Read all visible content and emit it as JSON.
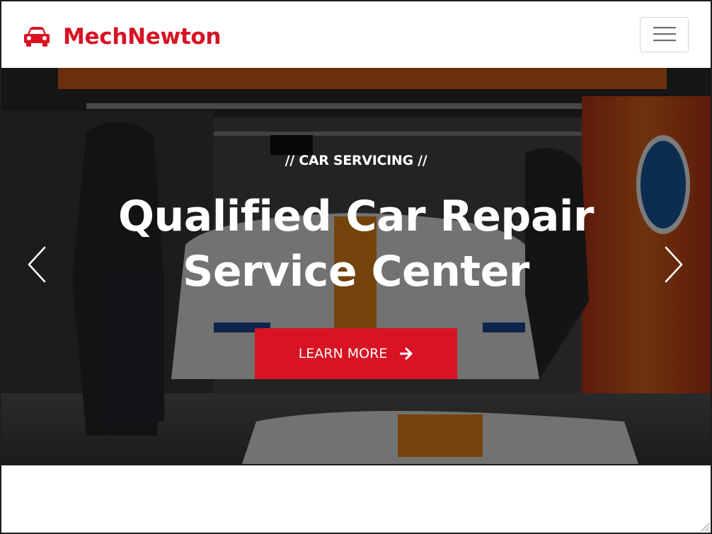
{
  "navbar": {
    "brand_name": "MechNewton",
    "brand_icon": "car-icon",
    "toggler_icon": "hamburger-menu-icon"
  },
  "hero": {
    "kicker": "// CAR SERVICING //",
    "headline_line1": "Qualified Car Repair",
    "headline_line2": "Service Center",
    "cta_label": "LEARN MORE",
    "cta_icon": "arrow-right-icon",
    "prev_icon": "chevron-left-icon",
    "next_icon": "chevron-right-icon"
  },
  "colors": {
    "brand": "#d81324",
    "text_on_dark": "#ffffff",
    "frame": "#1e1e1e"
  }
}
